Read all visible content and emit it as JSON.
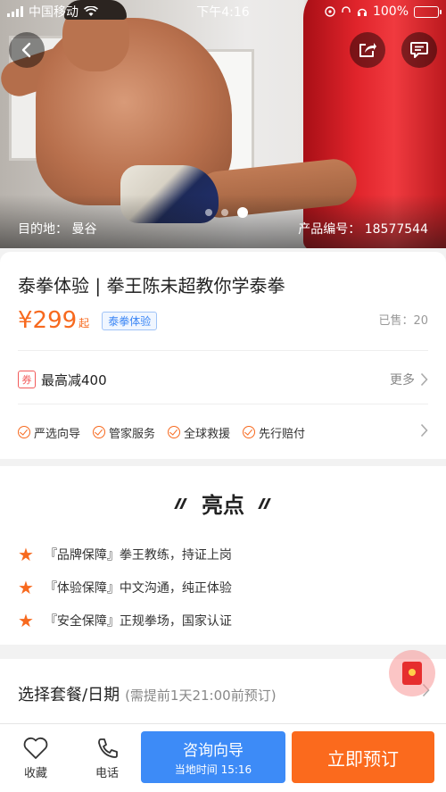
{
  "status_bar": {
    "carrier": "中国移动",
    "time": "下午4:16",
    "battery": "100%"
  },
  "hero": {
    "destination_label": "目的地：",
    "destination_value": "曼谷",
    "code_label": "产品编号：",
    "code_value": "18577544",
    "slides": 3,
    "active_slide": 3
  },
  "product": {
    "title": "泰拳体验 | 拳王陈未超教你学泰拳",
    "price": "¥299",
    "price_unit": "起",
    "tag": "泰拳体验",
    "sold": "已售：20"
  },
  "coupon": {
    "icon_text": "券",
    "text": "最高减400",
    "more": "更多"
  },
  "services": [
    "严选向导",
    "管家服务",
    "全球救援",
    "先行赔付"
  ],
  "highlights": {
    "title": "亮点",
    "items": [
      "『品牌保障』拳王教练，持证上岗",
      "『体验保障』中文沟通，纯正体验",
      "『安全保障』正规拳场，国家认证"
    ]
  },
  "package": {
    "title": "选择套餐/日期",
    "note": "(需提前1天21:00前预订)"
  },
  "bottom_bar": {
    "favorite": "收藏",
    "call": "电话",
    "consult_title": "咨询向导",
    "consult_sub": "当地时间 15:16",
    "book": "立即预订"
  },
  "colors": {
    "accent_orange": "#fb6a1d",
    "accent_blue": "#3d8bf7",
    "price": "#f7691e"
  }
}
